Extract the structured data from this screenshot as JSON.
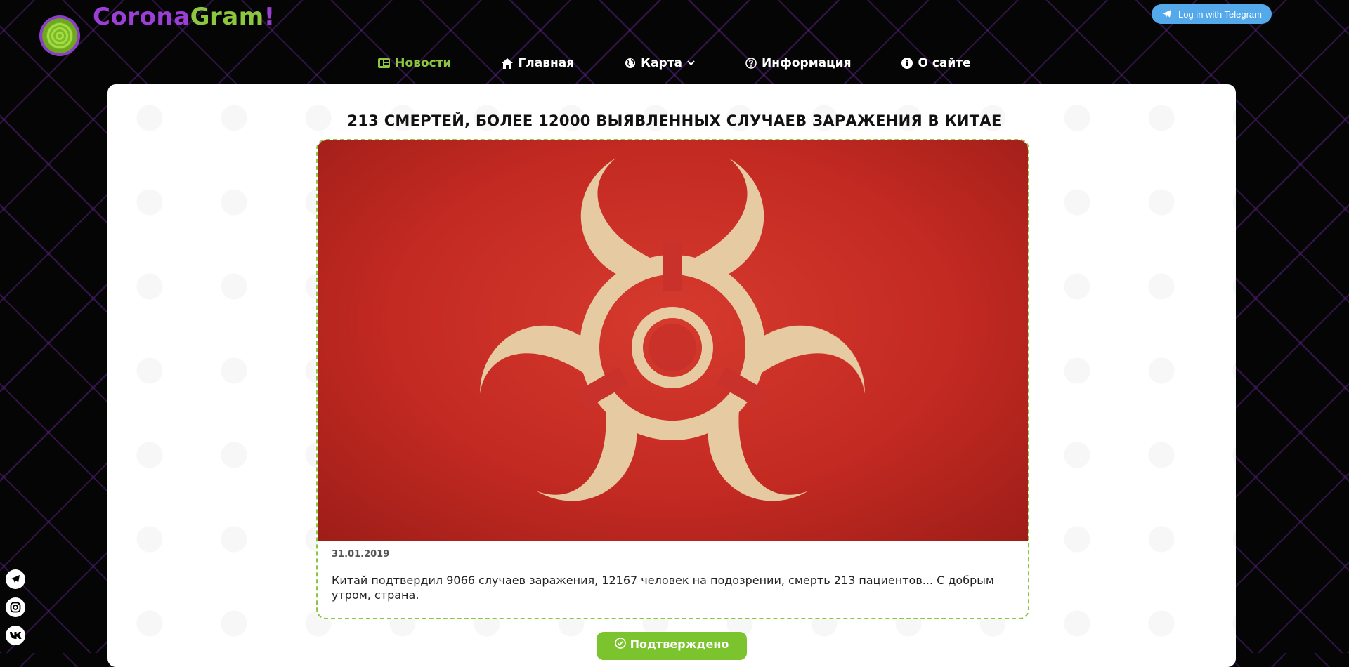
{
  "brand": {
    "part1": "Corona",
    "part2": "Gram",
    "part3": "!",
    "colors": {
      "purple": "#9b3fd6",
      "green": "#8dc63f"
    }
  },
  "login": {
    "label": "Log in with Telegram",
    "icon": "telegram-icon",
    "color": "#54a9eb"
  },
  "nav": {
    "news": {
      "label": "Новости",
      "icon": "news-icon"
    },
    "home": {
      "label": "Главная",
      "icon": "home-icon"
    },
    "map": {
      "label": "Карта",
      "icon": "globe-icon"
    },
    "info": {
      "label": "Информация",
      "icon": "question-icon"
    },
    "about": {
      "label": "О сайте",
      "icon": "info-icon"
    }
  },
  "article": {
    "title": "213 смертей, более 12000 выявленных случаев заражения в Китае",
    "image_icon": "biohazard-icon",
    "date": "31.01.2019",
    "text": "Китай подтвердил 9066 случаев заражения, 12167 человек на подозрении, смерть 213 пациентов... С добрым утром, страна."
  },
  "confirm_button": {
    "label": "Подтверждено",
    "icon": "check-circle-icon",
    "color": "#7cc42e"
  },
  "social": [
    {
      "name": "telegram",
      "icon": "telegram-icon"
    },
    {
      "name": "instagram",
      "icon": "instagram-icon"
    },
    {
      "name": "vk",
      "icon": "vk-icon"
    }
  ]
}
